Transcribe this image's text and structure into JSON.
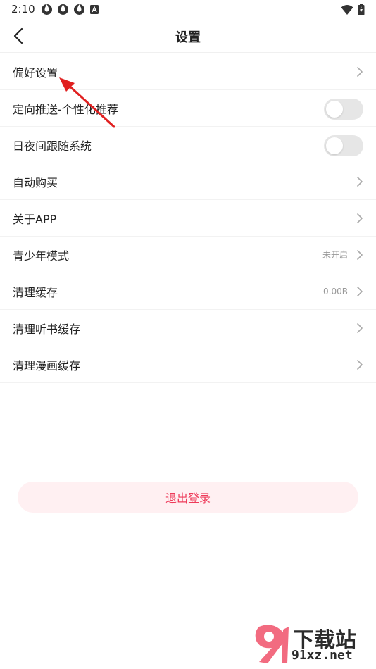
{
  "status_bar": {
    "time": "2:10"
  },
  "header": {
    "title": "设置"
  },
  "settings": {
    "items": [
      {
        "label": "偏好设置",
        "control": "chevron",
        "value": ""
      },
      {
        "label": "定向推送-个性化推荐",
        "control": "toggle",
        "value": ""
      },
      {
        "label": "日夜间跟随系统",
        "control": "toggle",
        "value": ""
      },
      {
        "label": "自动购买",
        "control": "chevron",
        "value": ""
      },
      {
        "label": "关于APP",
        "control": "chevron",
        "value": ""
      },
      {
        "label": "青少年模式",
        "control": "chevron",
        "value": "未开启"
      },
      {
        "label": "清理缓存",
        "control": "chevron",
        "value": "0.00B"
      },
      {
        "label": "清理听书缓存",
        "control": "chevron",
        "value": ""
      },
      {
        "label": "清理漫画缓存",
        "control": "chevron",
        "value": ""
      }
    ]
  },
  "logout": {
    "label": "退出登录"
  },
  "watermark": {
    "title": "下载站",
    "domain": "91xz.net"
  },
  "colors": {
    "accent": "#ee3b5a",
    "logout_bg": "#fff0f2",
    "toggle_off": "#e6e6e6",
    "annotation": "#e02020"
  }
}
